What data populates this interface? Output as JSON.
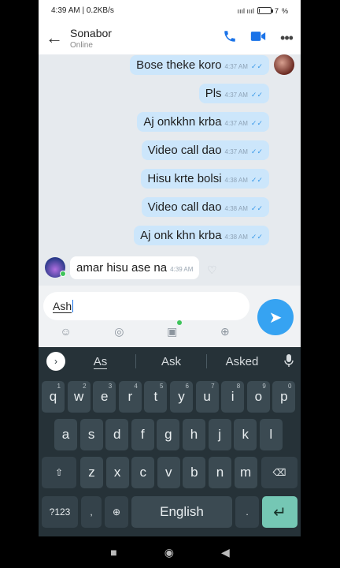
{
  "status": {
    "time": "4:39 AM",
    "speed": "0.2KB/s",
    "signal": "ıııl ıııl",
    "battery": "7",
    "battery_fraction": 0.07
  },
  "header": {
    "back": "←",
    "name": "Sonabor",
    "status": "Online",
    "call": "✆",
    "video": "■",
    "more": "•••"
  },
  "messages_out": [
    {
      "text": "Bose theke koro",
      "time": "4:37 AM",
      "tick": "✓✓"
    },
    {
      "text": "Pls",
      "time": "4:37 AM",
      "tick": "✓✓"
    },
    {
      "text": "Aj onkkhn krba",
      "time": "4:37 AM",
      "tick": "✓✓"
    },
    {
      "text": "Video call dao",
      "time": "4:37 AM",
      "tick": "✓✓"
    },
    {
      "text": "Hisu krte bolsi",
      "time": "4:38 AM",
      "tick": "✓✓"
    },
    {
      "text": "Video call dao",
      "time": "4:38 AM",
      "tick": "✓✓"
    },
    {
      "text": "Aj onk khn krba",
      "time": "4:38 AM",
      "tick": "✓✓"
    }
  ],
  "message_in": {
    "text": "amar hisu ase na",
    "time": "4:39 AM",
    "heart": "♡"
  },
  "composer": {
    "value": "Ash",
    "send": "➤",
    "tools": [
      "☺",
      "◎",
      "▣",
      "⊕"
    ]
  },
  "keyboard": {
    "suggestions": [
      "As",
      "Ask",
      "Asked"
    ],
    "chevron": "›",
    "mic": "●",
    "row1": [
      [
        "q",
        "1"
      ],
      [
        "w",
        "2"
      ],
      [
        "e",
        "3"
      ],
      [
        "r",
        "4"
      ],
      [
        "t",
        "5"
      ],
      [
        "y",
        "6"
      ],
      [
        "u",
        "7"
      ],
      [
        "i",
        "8"
      ],
      [
        "o",
        "9"
      ],
      [
        "p",
        "0"
      ]
    ],
    "row2": [
      "a",
      "s",
      "d",
      "f",
      "g",
      "h",
      "j",
      "k",
      "l"
    ],
    "row3": [
      "z",
      "x",
      "c",
      "v",
      "b",
      "n",
      "m"
    ],
    "shift": "⇧",
    "backspace": "⌫",
    "symbols": "?123",
    "emoji": "☺",
    "comma": ",",
    "globe": "⊕",
    "space": "English",
    "period": ".",
    "enter": "↵"
  },
  "navbar": {
    "recent": "■",
    "home": "◉",
    "back": "◀"
  }
}
